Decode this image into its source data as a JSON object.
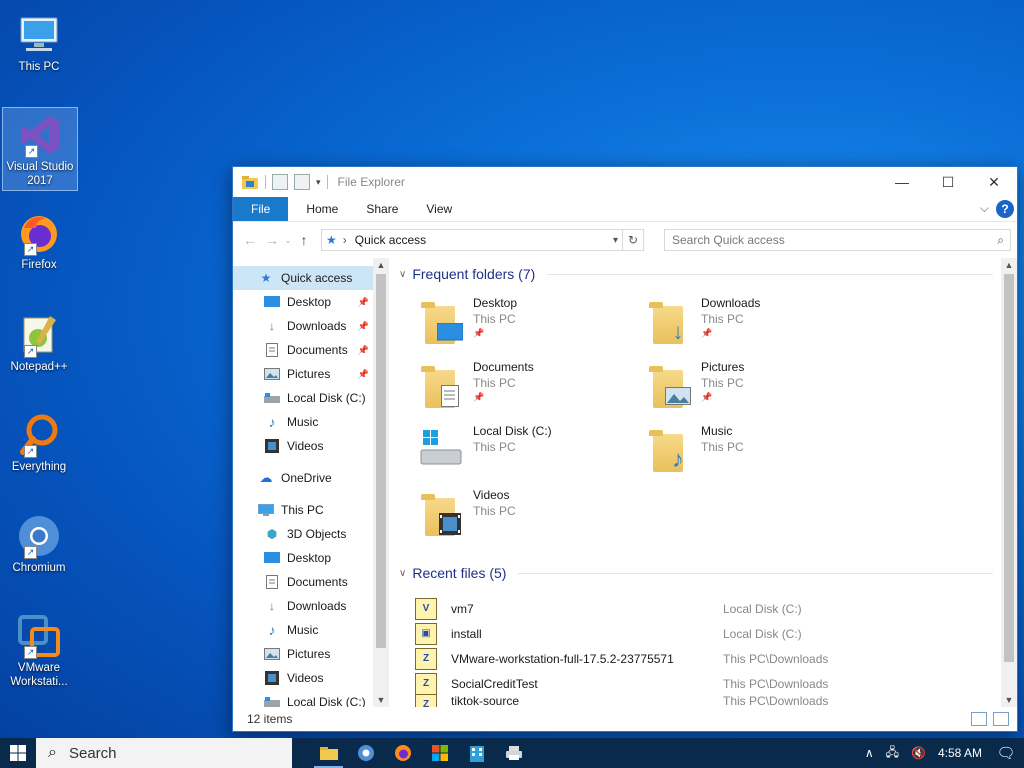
{
  "desktop": {
    "icons": [
      {
        "label": "This PC"
      },
      {
        "label": "Visual Studio 2017"
      },
      {
        "label": "Firefox"
      },
      {
        "label": "Notepad++"
      },
      {
        "label": "Everything"
      },
      {
        "label": "Chromium"
      },
      {
        "label": "VMware Workstati..."
      }
    ]
  },
  "window": {
    "title": "File Explorer",
    "ribbon_tabs": [
      "File",
      "Home",
      "Share",
      "View"
    ],
    "address": "Quick access",
    "search_placeholder": "Search Quick access",
    "status": "12 items"
  },
  "navpane": {
    "quick_access": "Quick access",
    "pinned": [
      "Desktop",
      "Downloads",
      "Documents",
      "Pictures"
    ],
    "unpinned": [
      "Local Disk (C:)",
      "Music",
      "Videos"
    ],
    "onedrive": "OneDrive",
    "this_pc": "This PC",
    "this_pc_items": [
      "3D Objects",
      "Desktop",
      "Documents",
      "Downloads",
      "Music",
      "Pictures",
      "Videos",
      "Local Disk (C:)"
    ]
  },
  "frequent": {
    "heading": "Frequent folders (7)",
    "items": [
      {
        "name": "Desktop",
        "sub": "This PC"
      },
      {
        "name": "Downloads",
        "sub": "This PC"
      },
      {
        "name": "Documents",
        "sub": "This PC"
      },
      {
        "name": "Pictures",
        "sub": "This PC"
      },
      {
        "name": "Local Disk (C:)",
        "sub": "This PC"
      },
      {
        "name": "Music",
        "sub": "This PC"
      },
      {
        "name": "Videos",
        "sub": "This PC"
      }
    ]
  },
  "recent": {
    "heading": "Recent files (5)",
    "items": [
      {
        "name": "vm7",
        "location": "Local Disk (C:)"
      },
      {
        "name": "install",
        "location": "Local Disk (C:)"
      },
      {
        "name": "VMware-workstation-full-17.5.2-23775571",
        "location": "This PC\\Downloads"
      },
      {
        "name": "SocialCreditTest",
        "location": "This PC\\Downloads"
      },
      {
        "name": "tiktok-source",
        "location": "This PC\\Downloads"
      }
    ]
  },
  "taskbar": {
    "search_label": "Search",
    "clock": "4:58 AM"
  },
  "colors": {
    "accent": "#1979ca",
    "selection": "#cde6f7",
    "taskbar": "#0a2a4c"
  }
}
